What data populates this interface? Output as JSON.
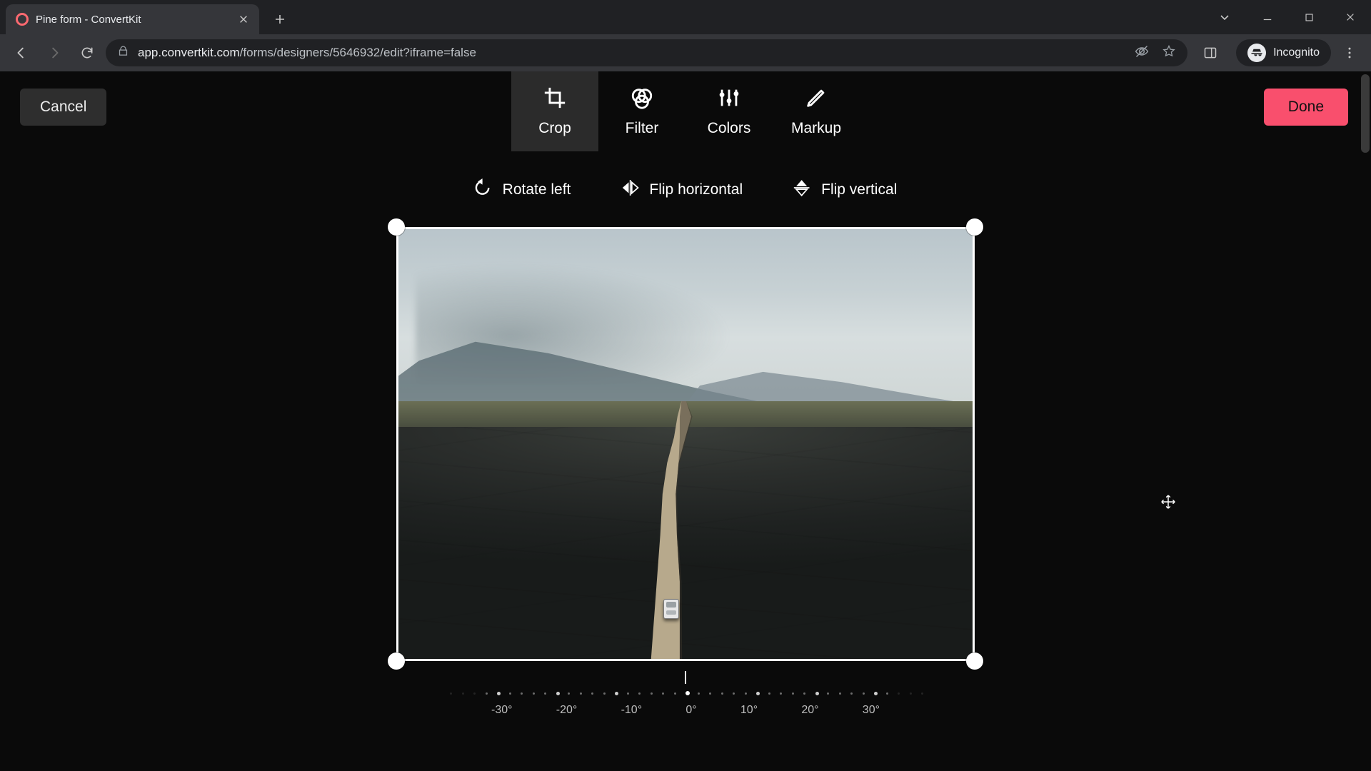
{
  "browser": {
    "tab_title": "Pine form - ConvertKit",
    "url_host": "app.convertkit.com",
    "url_path": "/forms/designers/5646932/edit?iframe=false",
    "incognito_label": "Incognito"
  },
  "editor": {
    "cancel_label": "Cancel",
    "done_label": "Done",
    "tabs": {
      "crop": "Crop",
      "filter": "Filter",
      "colors": "Colors",
      "markup": "Markup",
      "active": "crop"
    },
    "transform": {
      "rotate_left": "Rotate left",
      "flip_horizontal": "Flip horizontal",
      "flip_vertical": "Flip vertical"
    },
    "rotation": {
      "current_deg": 0,
      "labels": [
        "-30°",
        "-20°",
        "-10°",
        "0°",
        "10°",
        "20°",
        "30°"
      ]
    },
    "colors": {
      "accent": "#f94f6d",
      "background": "#0a0a0a"
    }
  }
}
